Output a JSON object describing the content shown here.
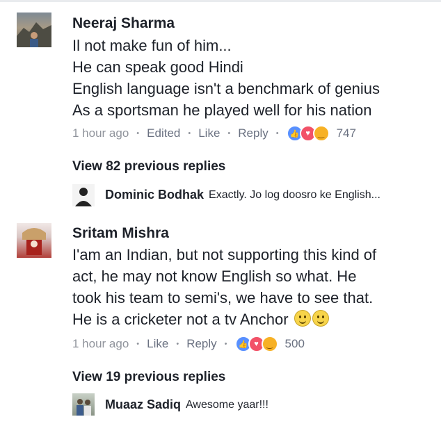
{
  "comments": [
    {
      "author": "Neeraj Sharma",
      "lines": [
        "Il not make fun of him...",
        "He can speak good Hindi",
        "English language isn't a benchmark of genius",
        "As a sportsman he played well for his nation"
      ],
      "time": "1 hour ago",
      "edited": "Edited",
      "like_label": "Like",
      "reply_label": "Reply",
      "reaction_icons": [
        "like-reaction-icon",
        "love-reaction-icon",
        "haha-reaction-icon"
      ],
      "reaction_count": "747",
      "view_replies": "View 82 previous replies",
      "latest_reply": {
        "author": "Dominic Bodhak",
        "text": "Exactly. Jo log doosro ke English..."
      }
    },
    {
      "author": "Sritam Mishra",
      "lines": [
        "I'am an Indian, but not supporting this kind of",
        "act, he may not know English so what. He",
        "took his team to semi's, we have to see that.",
        "He is a cricketer not a tv Anchor"
      ],
      "time": "1 hour ago",
      "like_label": "Like",
      "reply_label": "Reply",
      "reaction_icons": [
        "like-reaction-icon",
        "love-reaction-icon",
        "haha-reaction-icon"
      ],
      "reaction_count": "500",
      "view_replies": "View 19 previous replies",
      "latest_reply": {
        "author": "Muaaz Sadiq",
        "text": "Awesome yaar!!!"
      }
    }
  ],
  "colors": {
    "link_blue": "#5890ff",
    "meta_gray": "#90949c",
    "love_red": "#f25268",
    "haha_yellow": "#f7b125"
  }
}
